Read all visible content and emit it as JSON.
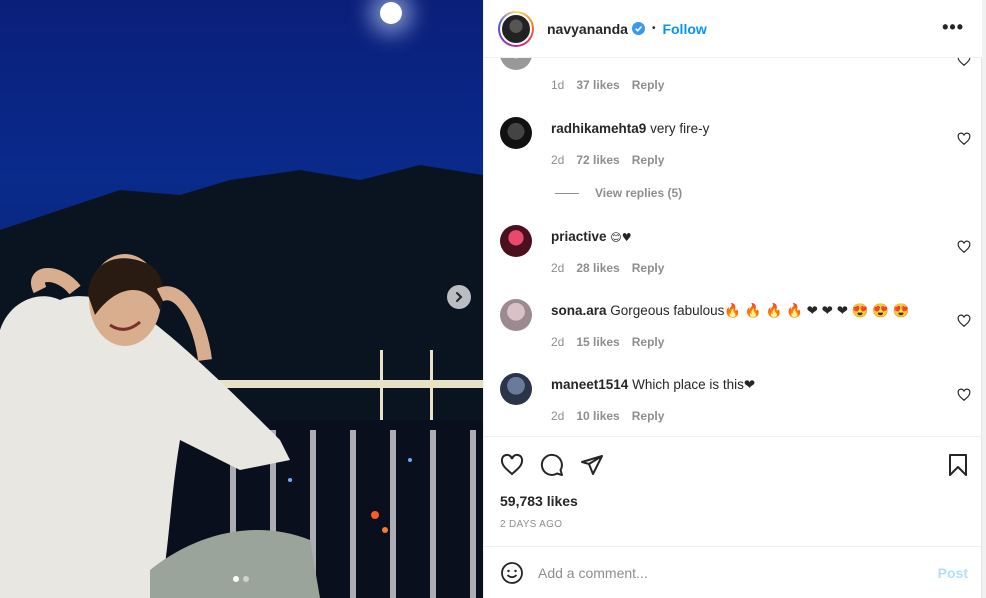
{
  "post": {
    "username": "navyananda",
    "separator": "•",
    "follow_label": "Follow",
    "more_label": "•••"
  },
  "comments": [
    {
      "username": "",
      "text": "",
      "time": "1d",
      "likes": "37 likes",
      "reply": "Reply"
    },
    {
      "username": "radhikamehta9",
      "text": "very fire-y",
      "time": "2d",
      "likes": "72 likes",
      "reply": "Reply"
    },
    {
      "username": "priactive",
      "text": "😊♥",
      "time": "2d",
      "likes": "28 likes",
      "reply": "Reply"
    },
    {
      "username": "sona.ara",
      "text": "Gorgeous fabulous🔥 🔥 🔥 🔥 ❤ ❤ ❤ 😍 😍 😍",
      "time": "2d",
      "likes": "15 likes",
      "reply": "Reply"
    },
    {
      "username": "maneet1514",
      "text": "Which place is this❤",
      "time": "2d",
      "likes": "10 likes",
      "reply": "Reply"
    }
  ],
  "view_replies": "View replies (5)",
  "actions": {
    "likes": "59,783 likes",
    "date": "2 DAYS AGO"
  },
  "add_comment": {
    "placeholder": "Add a comment...",
    "post_label": "Post"
  },
  "carousel": {
    "current": 1,
    "total": 2
  },
  "colors": {
    "follow": "#0095f6",
    "post_disabled": "#b2dffc",
    "verified": "#3897f0"
  },
  "icons": [
    "heart-icon",
    "comment-icon",
    "share-icon",
    "bookmark-icon",
    "emoji-icon",
    "chevron-right-icon",
    "verified-badge-icon",
    "more-options-icon"
  ]
}
